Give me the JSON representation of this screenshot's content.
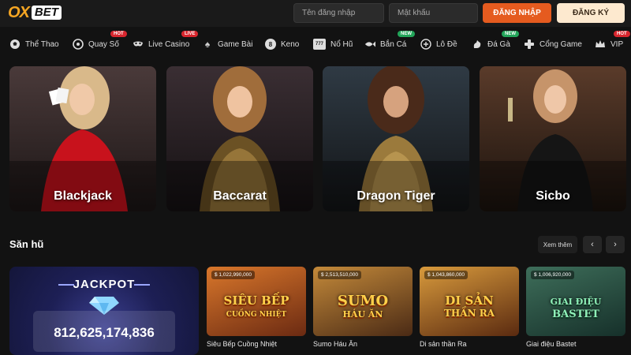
{
  "logo": {
    "ox": "OX",
    "bet": "BET"
  },
  "header": {
    "username_placeholder": "Tên đăng nhập",
    "password_placeholder": "Mật khẩu",
    "login_label": "ĐĂNG NHẬP",
    "register_label": "ĐĂNG KÝ"
  },
  "nav": [
    {
      "label": "Thể Thao",
      "icon": "soccer-ball-icon"
    },
    {
      "label": "Quay Số",
      "icon": "lottery-ball-icon",
      "badge": "HOT"
    },
    {
      "label": "Live Casino",
      "icon": "mask-icon",
      "badge": "LIVE"
    },
    {
      "label": "Game Bài",
      "icon": "spade-icon"
    },
    {
      "label": "Keno",
      "icon": "keno-ball-icon",
      "glyph": "8"
    },
    {
      "label": "Nổ Hũ",
      "icon": "slot-777-icon",
      "glyph": "777"
    },
    {
      "label": "Bắn Cá",
      "icon": "fish-icon",
      "badge": "NEW"
    },
    {
      "label": "Lô Đề",
      "icon": "lotto-icon"
    },
    {
      "label": "Đá Gà",
      "icon": "rooster-icon",
      "badge": "NEW"
    },
    {
      "label": "Cổng Game",
      "icon": "gamepad-icon"
    },
    {
      "label": "VIP",
      "icon": "crown-icon",
      "badge": "HOT"
    }
  ],
  "casino_cards": [
    {
      "label": "Blackjack"
    },
    {
      "label": "Baccarat"
    },
    {
      "label": "Dragon Tiger"
    },
    {
      "label": "Sicbo"
    }
  ],
  "section": {
    "title": "Săn hũ",
    "more_label": "Xem thêm",
    "prev_glyph": "‹",
    "next_glyph": "›"
  },
  "jackpot": {
    "title": "JACKPOT",
    "value": "812,625,174,836"
  },
  "games": [
    {
      "name": "Siêu Bếp Cuồng Nhiệt",
      "amount": "$ 1,022,990,000",
      "art_title": "SIÊU BẾP",
      "art_sub": "CUỒNG NHIỆT"
    },
    {
      "name": "Sumo Háu Ăn",
      "amount": "$ 2,513,510,000",
      "art_title": "SUMO",
      "art_sub": "HÁU ĂN"
    },
    {
      "name": "Di sản thần Ra",
      "amount": "$ 1,043,860,000",
      "art_title": "DI SẢN",
      "art_sub": "THẦN RA"
    },
    {
      "name": "Giai điệu Bastet",
      "amount": "$ 1,006,920,000",
      "art_title": "GIAI ĐIỆU",
      "art_sub": "BASTET"
    }
  ],
  "colors": {
    "accent": "#e55b1f",
    "logo": "#f5a623",
    "background": "#121212"
  }
}
